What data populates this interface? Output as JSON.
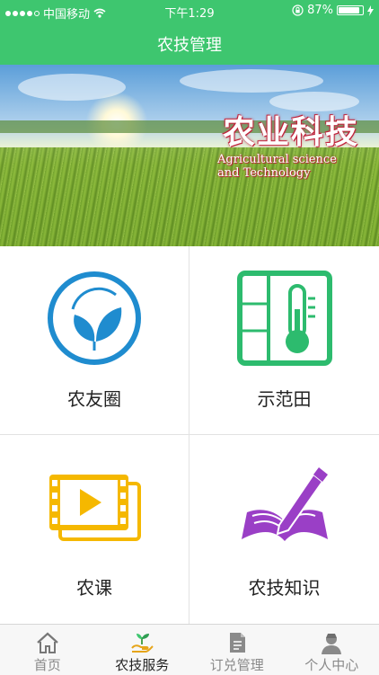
{
  "status_bar": {
    "carrier": "中国移动",
    "time": "下午1:29",
    "battery": "87%",
    "battery_level": 0.87
  },
  "header": {
    "title": "农技管理"
  },
  "banner": {
    "title": "农业科技",
    "subtitle": "Agricultural science and Technology"
  },
  "grid": [
    {
      "label": "农友圈",
      "icon": "leaves-icon",
      "color": "#1f8ccf"
    },
    {
      "label": "示范田",
      "icon": "thermometer-icon",
      "color": "#2dbb6e"
    },
    {
      "label": "农课",
      "icon": "video-film-icon",
      "color": "#f5b800"
    },
    {
      "label": "农技知识",
      "icon": "book-pen-icon",
      "color": "#9a3fc6"
    }
  ],
  "tabs": [
    {
      "label": "首页",
      "icon": "home-icon",
      "active": false
    },
    {
      "label": "农技服务",
      "icon": "sprout-hand-icon",
      "active": true
    },
    {
      "label": "订兑管理",
      "icon": "document-icon",
      "active": false
    },
    {
      "label": "个人中心",
      "icon": "user-icon",
      "active": false
    }
  ],
  "colors": {
    "brand": "#3ec66f",
    "tab_inactive": "#8a8a8a"
  }
}
